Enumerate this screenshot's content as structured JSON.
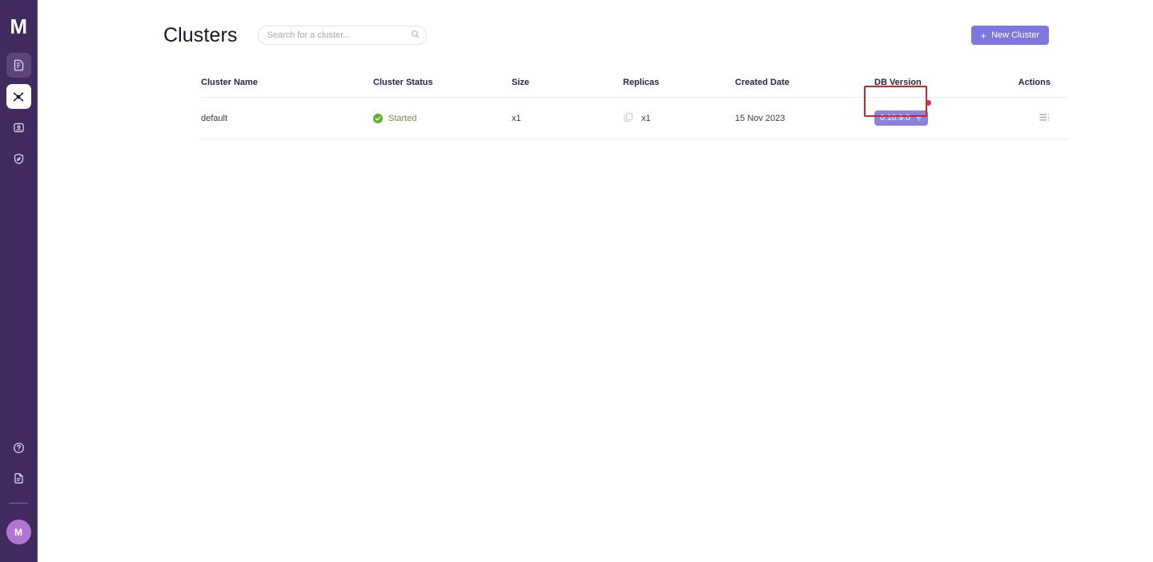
{
  "app": {
    "logo_text": "M",
    "accent_purple": "#7e77e0",
    "sidebar_bg": "#412a5d",
    "status_green": "#5cb030",
    "highlight_red": "#d32323"
  },
  "sidebar": {
    "items": [
      {
        "name": "sidebar-item-shell",
        "icon": "database-document-icon",
        "state": "hovered"
      },
      {
        "name": "sidebar-item-clusters",
        "icon": "cluster-nodes-icon",
        "state": "active"
      },
      {
        "name": "sidebar-item-connections",
        "icon": "id-card-icon",
        "state": "default"
      },
      {
        "name": "sidebar-item-security",
        "icon": "shield-compass-icon",
        "state": "default"
      }
    ],
    "bottom_items": [
      {
        "name": "sidebar-item-help",
        "icon": "help-circle-icon"
      },
      {
        "name": "sidebar-item-docs",
        "icon": "document-icon"
      }
    ],
    "avatar_initial": "M"
  },
  "header": {
    "title": "Clusters",
    "search": {
      "placeholder": "Search for a cluster...",
      "value": "",
      "icon": "search-icon"
    },
    "new_cluster_button": {
      "label": "New Cluster",
      "plus": "+"
    }
  },
  "table": {
    "columns": [
      {
        "key": "cluster_name",
        "label": "Cluster Name"
      },
      {
        "key": "cluster_status",
        "label": "Cluster Status"
      },
      {
        "key": "size",
        "label": "Size"
      },
      {
        "key": "replicas",
        "label": "Replicas"
      },
      {
        "key": "created_date",
        "label": "Created Date"
      },
      {
        "key": "db_version",
        "label": "DB Version"
      },
      {
        "key": "actions",
        "label": "Actions"
      }
    ],
    "rows": [
      {
        "cluster_name": "default",
        "cluster_status": "Started",
        "status_icon": "check-circle-icon",
        "size": "x1",
        "replicas": "x1",
        "replicas_icon": "replica-copy-icon",
        "created_date": "15 Nov 2023",
        "db_version": "0.10.9.0",
        "db_version_icon": "upgrade-arrow-icon",
        "has_update_dot": true,
        "actions_icon": "list-actions-icon"
      }
    ]
  }
}
